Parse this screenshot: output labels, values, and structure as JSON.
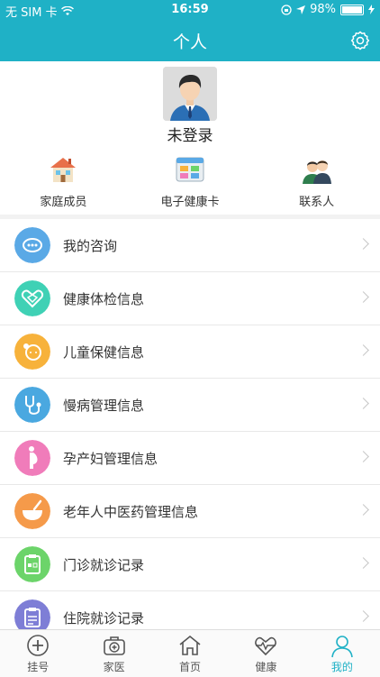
{
  "status_bar": {
    "carrier": "无 SIM 卡",
    "time": "16:59",
    "battery": "98%"
  },
  "header": {
    "title": "个人"
  },
  "profile": {
    "username": "未登录"
  },
  "quick_links": [
    {
      "label": "家庭成员",
      "icon": "house-icon"
    },
    {
      "label": "电子健康卡",
      "icon": "health-card-icon"
    },
    {
      "label": "联系人",
      "icon": "contacts-icon"
    }
  ],
  "menu": [
    {
      "label": "我的咨询",
      "icon": "chat-bubble-icon",
      "color": "#5aa9e6"
    },
    {
      "label": "健康体检信息",
      "icon": "heart-hands-icon",
      "color": "#3fd1b5"
    },
    {
      "label": "儿童保健信息",
      "icon": "baby-icon",
      "color": "#f7b23b"
    },
    {
      "label": "慢病管理信息",
      "icon": "stethoscope-icon",
      "color": "#4aa8e0"
    },
    {
      "label": "孕产妇管理信息",
      "icon": "pregnant-icon",
      "color": "#f07cba"
    },
    {
      "label": "老年人中医药管理信息",
      "icon": "mortar-icon",
      "color": "#f59a4a"
    },
    {
      "label": "门诊就诊记录",
      "icon": "clipboard-icon",
      "color": "#6cd46a"
    },
    {
      "label": "住院就诊记录",
      "icon": "record-icon",
      "color": "#7e7ed6"
    }
  ],
  "tabs": [
    {
      "label": "挂号",
      "icon": "plus-circle-icon",
      "active": false
    },
    {
      "label": "家医",
      "icon": "medical-kit-icon",
      "active": false
    },
    {
      "label": "首页",
      "icon": "home-icon",
      "active": false
    },
    {
      "label": "健康",
      "icon": "heartbeat-icon",
      "active": false
    },
    {
      "label": "我的",
      "icon": "person-icon",
      "active": true
    }
  ]
}
